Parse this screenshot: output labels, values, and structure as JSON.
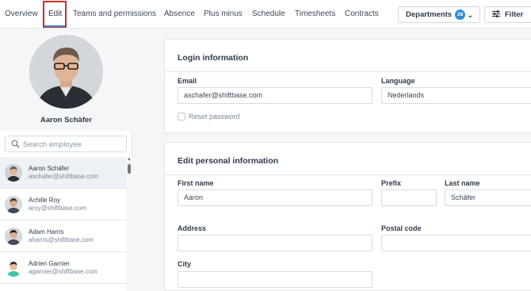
{
  "nav": {
    "tabs": [
      {
        "label": "Overview"
      },
      {
        "label": "Edit"
      },
      {
        "label": "Teams and permissions"
      },
      {
        "label": "Absence"
      },
      {
        "label": "Plus minus"
      },
      {
        "label": "Schedule"
      },
      {
        "label": "Timesheets"
      },
      {
        "label": "Contracts"
      }
    ],
    "active_tab": "Edit",
    "departments_label": "Departments",
    "departments_count": "28",
    "filter_label": "Filter"
  },
  "profile": {
    "name": "Aaron Schäfer"
  },
  "search": {
    "placeholder": "Search employee"
  },
  "employees": [
    {
      "name": "Aaron Schäfer",
      "email": "aschafer@shiftbase.com",
      "selected": true
    },
    {
      "name": "Achille Roy",
      "email": "aroy@shiftbase.com",
      "selected": false
    },
    {
      "name": "Adam Harris",
      "email": "aharris@shiftbase.com",
      "selected": false
    },
    {
      "name": "Adrien Garnier",
      "email": "agarnier@shiftbase.com",
      "selected": false
    }
  ],
  "login": {
    "title": "Login information",
    "email_label": "Email",
    "email_value": "aschafer@shiftbase.com",
    "language_label": "Language",
    "language_value": "Nederlands",
    "reset_password_label": "Reset password"
  },
  "personal": {
    "title": "Edit personal information",
    "first_name_label": "First name",
    "first_name_value": "Aaron",
    "prefix_label": "Prefix",
    "prefix_value": "",
    "last_name_label": "Last name",
    "last_name_value": "Schäfer",
    "address_label": "Address",
    "address_value": "",
    "postal_code_label": "Postal code",
    "postal_code_value": "",
    "city_label": "City",
    "city_value": ""
  },
  "colors": {
    "accent": "#2b8fd6",
    "highlight": "#d9262c"
  }
}
